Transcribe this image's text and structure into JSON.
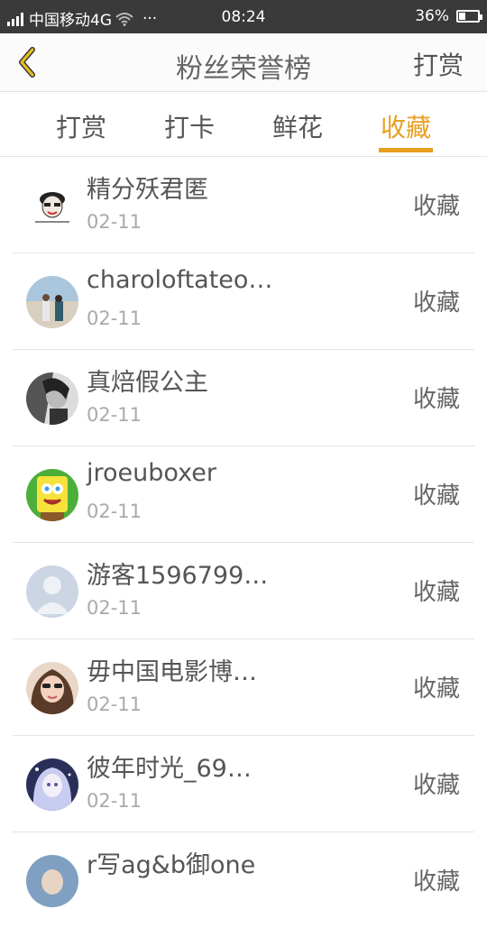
{
  "status_bar": {
    "carrier": "中国移动4G",
    "extra": "···",
    "time": "08:24",
    "battery_text": "36%",
    "battery_level": 0.36
  },
  "header": {
    "title": "粉丝荣誉榜",
    "action_label": "打赏",
    "accent_color": "#e8a020"
  },
  "tabs": [
    {
      "label": "打赏",
      "active": false
    },
    {
      "label": "打卡",
      "active": false
    },
    {
      "label": "鲜花",
      "active": false
    },
    {
      "label": "收藏",
      "active": true
    }
  ],
  "list": [
    {
      "name": "精分殀君匿",
      "date": "02-11",
      "action": "收藏",
      "avatar_icon": "cartoon-avatar-icon"
    },
    {
      "name": "charoloftateo…",
      "date": "02-11",
      "action": "收藏",
      "avatar_icon": "beach-photo-avatar-icon"
    },
    {
      "name": "真焙假公主",
      "date": "02-11",
      "action": "收藏",
      "avatar_icon": "bw-photo-avatar-icon"
    },
    {
      "name": "jroeuboxer",
      "date": "02-11",
      "action": "收藏",
      "avatar_icon": "spongebob-avatar-icon"
    },
    {
      "name": "游客1596799…",
      "date": "02-11",
      "action": "收藏",
      "avatar_icon": "default-user-avatar-icon"
    },
    {
      "name": "毋中国电影博…",
      "date": "02-11",
      "action": "收藏",
      "avatar_icon": "girl-photo-avatar-icon"
    },
    {
      "name": "彼年时光_69…",
      "date": "02-11",
      "action": "收藏",
      "avatar_icon": "anime-avatar-icon"
    },
    {
      "name": "r写ag&b御one",
      "date": "",
      "action": "收藏",
      "avatar_icon": "photo-avatar-icon"
    }
  ]
}
